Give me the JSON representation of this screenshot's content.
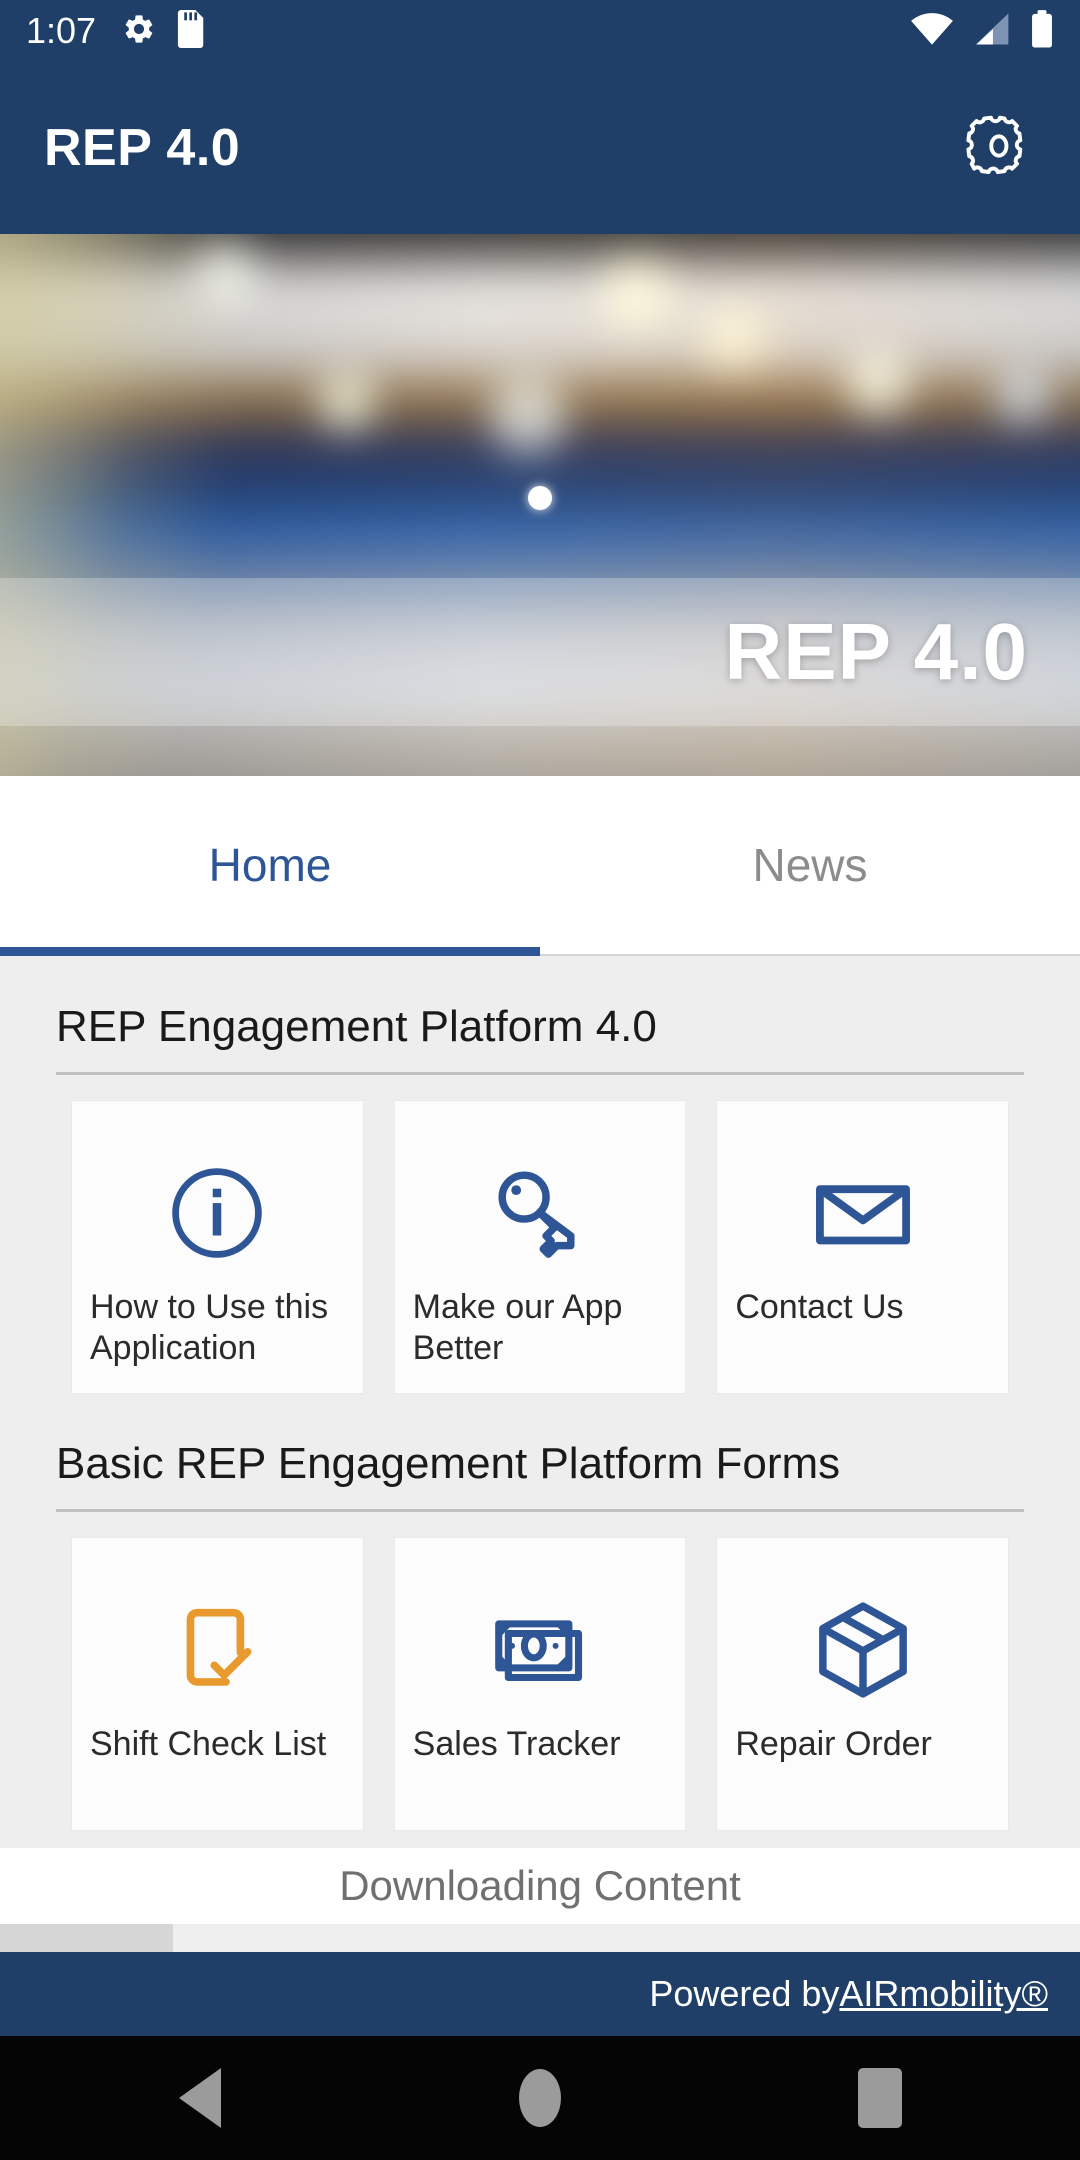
{
  "status_bar": {
    "time": "1:07",
    "icons": [
      "gear-icon",
      "sd-card-icon",
      "wifi-icon",
      "cellular-signal-icon",
      "battery-icon"
    ]
  },
  "app_bar": {
    "title": "REP 4.0",
    "settings_icon": "gear-icon"
  },
  "hero": {
    "overlay_title": "REP 4.0",
    "carousel_indicator": "active-dot"
  },
  "tabs": [
    {
      "label": "Home",
      "active": true
    },
    {
      "label": "News",
      "active": false
    }
  ],
  "sections": [
    {
      "title": "REP Engagement Platform 4.0",
      "cards": [
        {
          "label": "How to Use this Application",
          "icon": "info-circle-icon",
          "color": "#2e5596"
        },
        {
          "label": "Make our App Better",
          "icon": "key-icon",
          "color": "#2e5596"
        },
        {
          "label": "Contact Us",
          "icon": "envelope-icon",
          "color": "#2e5596"
        }
      ]
    },
    {
      "title": "Basic REP Engagement Platform Forms",
      "cards": [
        {
          "label": "Shift Check List",
          "icon": "checklist-document-icon",
          "color": "#e89a2e"
        },
        {
          "label": "Sales Tracker",
          "icon": "banknote-icon",
          "color": "#2e5596"
        },
        {
          "label": "Repair Order",
          "icon": "package-box-icon",
          "color": "#2e5596"
        }
      ]
    }
  ],
  "download": {
    "message": "Downloading Content",
    "progress_percent": 16
  },
  "footer": {
    "prefix": "Powered by ",
    "brand": "AIRmobility®"
  },
  "nav_bar": {
    "back": "back-triangle-icon",
    "home": "home-circle-icon",
    "recents": "recents-square-icon"
  },
  "colors": {
    "primary_blue": "#1f3f68",
    "accent_blue": "#2e5596",
    "accent_orange": "#e89a2e",
    "content_bg": "#eeeeee",
    "card_bg": "#fcfcfc"
  }
}
